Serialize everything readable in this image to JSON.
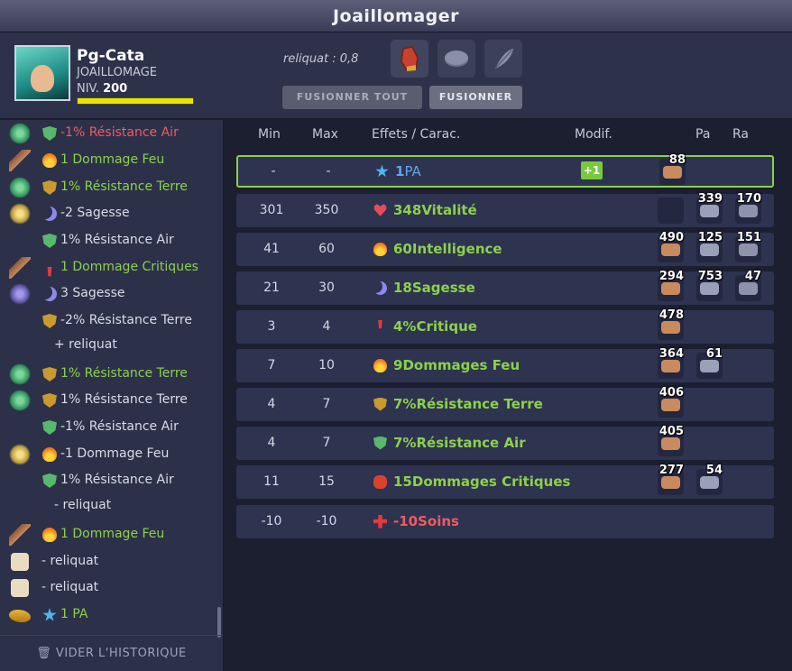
{
  "window": {
    "title": "Joaillomager"
  },
  "player": {
    "name": "Pg-Cata",
    "class": "JOAILLOMAGE",
    "level_label": "NIV.",
    "level": "200",
    "xp_fraction": 1.0
  },
  "reliquat_text": "reliquat : 0,8",
  "buttons": {
    "fuse_all": "FUSIONNER TOUT",
    "fuse": "FUSIONNER"
  },
  "history": [
    {
      "item_icon": "green-rune-item",
      "effect_icon": "shield-air-icon",
      "text": "-1% Résistance Air",
      "tone": "neg"
    },
    {
      "item_icon": "wood-item",
      "effect_icon": "fire-icon",
      "text": "1 Dommage Feu",
      "tone": "pos"
    },
    {
      "item_icon": "green-rune-item",
      "effect_icon": "shield-earth-icon",
      "text": "1% Résistance Terre",
      "tone": "pos"
    },
    {
      "item_icon": "gold-item",
      "effect_icon": "moon-icon",
      "text": "-2 Sagesse",
      "tone": "neu"
    },
    {
      "item_icon": "",
      "effect_icon": "shield-air-icon",
      "text": "1% Résistance Air",
      "tone": "neu"
    },
    {
      "item_icon": "wood-item",
      "effect_icon": "crit-icon",
      "text": "1 Dommage Critiques",
      "tone": "pos"
    },
    {
      "item_icon": "purple-item",
      "effect_icon": "moon-icon",
      "text": "3 Sagesse",
      "tone": "neu"
    },
    {
      "item_icon": "",
      "effect_icon": "shield-earth-icon",
      "text": "-2% Résistance Terre",
      "tone": "neu"
    },
    {
      "item_icon": "",
      "effect_icon": "",
      "text": "+ reliquat",
      "tone": "neu"
    },
    {
      "item_icon": "green-rune-item",
      "effect_icon": "shield-earth-icon",
      "text": "1% Résistance Terre",
      "tone": "pos"
    },
    {
      "item_icon": "green-rune-item",
      "effect_icon": "shield-earth-icon",
      "text": "1% Résistance Terre",
      "tone": "neu"
    },
    {
      "item_icon": "",
      "effect_icon": "shield-air-icon",
      "text": "-1% Résistance Air",
      "tone": "neu"
    },
    {
      "item_icon": "gold-item",
      "effect_icon": "fire-icon",
      "text": "-1 Dommage Feu",
      "tone": "neu"
    },
    {
      "item_icon": "",
      "effect_icon": "shield-air-icon",
      "text": "1% Résistance Air",
      "tone": "neu"
    },
    {
      "item_icon": "",
      "effect_icon": "",
      "text": "- reliquat",
      "tone": "neu"
    },
    {
      "item_icon": "wood-item",
      "effect_icon": "fire-icon",
      "text": "1 Dommage Feu",
      "tone": "pos"
    },
    {
      "item_icon": "dice-item",
      "effect_icon": "",
      "text": "- reliquat",
      "tone": "neu"
    },
    {
      "item_icon": "dice-item",
      "effect_icon": "",
      "text": "- reliquat",
      "tone": "neu"
    },
    {
      "item_icon": "lamp-item",
      "effect_icon": "star-icon",
      "text": "1 PA",
      "tone": "pos"
    }
  ],
  "clear_history": "VIDER L'HISTORIQUE",
  "table": {
    "headers": {
      "min": "Min",
      "max": "Max",
      "effects": "Effets / Carac.",
      "modif": "Modif.",
      "pa": "Pa",
      "ra": "Ra"
    },
    "rows": [
      {
        "min": "-",
        "max": "-",
        "icon": "star-icon",
        "value": "1",
        "name": "PA",
        "color": "#5fa8e8",
        "modif": "+1",
        "runes": [
          {
            "q": "88",
            "slot": "pa"
          }
        ]
      },
      {
        "min": "301",
        "max": "350",
        "icon": "heart-icon",
        "value": "348",
        "name": "Vitalité",
        "color": "#8cd14a",
        "runes": [
          {
            "q": "",
            "slot": "pa"
          },
          {
            "q": "339",
            "slot": "ra"
          },
          {
            "q": "170",
            "slot": "x3"
          }
        ]
      },
      {
        "min": "41",
        "max": "60",
        "icon": "fire-icon",
        "value": "60",
        "name": "Intelligence",
        "color": "#8cd14a",
        "runes": [
          {
            "q": "490",
            "slot": "pa"
          },
          {
            "q": "125",
            "slot": "ra"
          },
          {
            "q": "151",
            "slot": "x3"
          }
        ]
      },
      {
        "min": "21",
        "max": "30",
        "icon": "moon-icon",
        "value": "18",
        "name": "Sagesse",
        "color": "#8cd14a",
        "runes": [
          {
            "q": "294",
            "slot": "pa"
          },
          {
            "q": "753",
            "slot": "ra"
          },
          {
            "q": "47",
            "slot": "x3"
          }
        ]
      },
      {
        "min": "3",
        "max": "4",
        "icon": "crit-icon",
        "value": "4%",
        "name": "Critique",
        "color": "#8cd14a",
        "runes": [
          {
            "q": "478",
            "slot": "pa"
          }
        ]
      },
      {
        "min": "7",
        "max": "10",
        "icon": "fire-icon",
        "value": "9",
        "name": "Dommages Feu",
        "color": "#8cd14a",
        "runes": [
          {
            "q": "364",
            "slot": "pa"
          },
          {
            "q": "61",
            "slot": "ra"
          }
        ]
      },
      {
        "min": "4",
        "max": "7",
        "icon": "shield-earth-icon",
        "value": "7%",
        "name": "Résistance Terre",
        "color": "#8cd14a",
        "runes": [
          {
            "q": "406",
            "slot": "pa"
          }
        ]
      },
      {
        "min": "4",
        "max": "7",
        "icon": "shield-air-icon",
        "value": "7%",
        "name": "Résistance Air",
        "color": "#8cd14a",
        "runes": [
          {
            "q": "405",
            "slot": "pa"
          }
        ]
      },
      {
        "min": "11",
        "max": "15",
        "icon": "bug-icon",
        "value": "15",
        "name": "Dommages Critiques",
        "color": "#8cd14a",
        "runes": [
          {
            "q": "277",
            "slot": "pa"
          },
          {
            "q": "54",
            "slot": "ra"
          }
        ]
      },
      {
        "min": "-10",
        "max": "-10",
        "icon": "cross-icon",
        "value": "-10",
        "name": "Soins",
        "color": "#ef5b62",
        "runes": []
      }
    ]
  }
}
